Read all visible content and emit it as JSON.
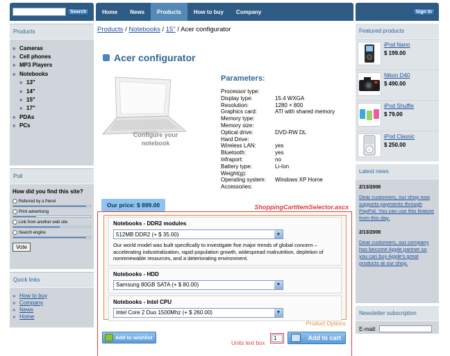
{
  "search": {
    "placeholder": "",
    "button": "Search"
  },
  "nav": {
    "items": [
      "Home",
      "News",
      "Products",
      "How to buy",
      "Company"
    ],
    "active": "Products"
  },
  "signin": "Sign In",
  "left": {
    "products_header": "Products",
    "categories": [
      {
        "label": "Cameras",
        "sub": false
      },
      {
        "label": "Cell phones",
        "sub": false
      },
      {
        "label": "MP3 Players",
        "sub": false
      },
      {
        "label": "Notebooks",
        "sub": false
      },
      {
        "label": "13\"",
        "sub": true
      },
      {
        "label": "14\"",
        "sub": true
      },
      {
        "label": "15\"",
        "sub": true
      },
      {
        "label": "17\"",
        "sub": true
      },
      {
        "label": "PDAs",
        "sub": false
      },
      {
        "label": "PCs",
        "sub": false
      }
    ],
    "poll": {
      "header": "Poll",
      "question": "How did you find this site?",
      "options": [
        {
          "label": "Referred by a friend",
          "share": 0.95
        },
        {
          "label": "Print advertising",
          "share": 0.3
        },
        {
          "label": "Link from another web site",
          "share": 0.6
        },
        {
          "label": "Search engine",
          "share": 0.95
        }
      ],
      "vote": "Vote"
    },
    "quick_links": {
      "header": "Quick links",
      "items": [
        "How to buy",
        "Company",
        "News",
        "Home"
      ]
    }
  },
  "breadcrumb": {
    "items": [
      "Products",
      "Notebooks",
      "15\""
    ],
    "current": "Acer configurator",
    "sep": " / "
  },
  "page_title": "Acer configurator",
  "configure_caption": "Configure your notebook",
  "params": {
    "title": "Parameters:",
    "rows": [
      [
        "Processor type:",
        ""
      ],
      [
        "Display type:",
        "15.4 WXGA"
      ],
      [
        "Resolution:",
        "1280 × 800"
      ],
      [
        "Graphics card:",
        "ATI with shared memory"
      ],
      [
        "Memory type:",
        ""
      ],
      [
        "Memory size:",
        ""
      ],
      [
        "Optical drive:",
        "DVD-RW DL"
      ],
      [
        "Hard Drive:",
        ""
      ],
      [
        "Wireless LAN:",
        "yes"
      ],
      [
        "Bluetooth:",
        "yes"
      ],
      [
        "Infraport:",
        "no"
      ],
      [
        "Battery type:",
        "Li-Ion"
      ],
      [
        "Weight(g):",
        ""
      ],
      [
        "Operating system:",
        "Windows XP Home"
      ],
      [
        "Accessories:",
        ""
      ]
    ]
  },
  "price": {
    "label": "Our price:",
    "value": "$ 899.00"
  },
  "selector_label": "ShoppingCartItemSelector.ascx",
  "options": [
    {
      "title": "Notebooks - DDR2 modules",
      "selected": "512MB DDR2 (+ $ 35.00)",
      "description": "Our world model was built specifically to investigate five major trends of global concern – accelerating industrialization, rapid population growth, widespread malnutrition, depletion of nonrenewable resources, and a deteriorating environment."
    },
    {
      "title": "Notebooks - HDD",
      "selected": "Samsung 80GB SATA (+ $ 80.00)",
      "description": ""
    },
    {
      "title": "Notebooks - Intel CPU",
      "selected": "Intel Core 2 Duo 1500Mhz (+ $ 260.00)",
      "description": ""
    }
  ],
  "product_options_label": "Product Options",
  "wishlist": "Add to wishlist",
  "units": {
    "value": "1",
    "label": "Units text box"
  },
  "add_to_cart": "Add to cart",
  "right": {
    "featured_header": "Featured products",
    "featured": [
      {
        "name": "iPod Nano",
        "price": "$ 199.00",
        "icon": "ipod-nano-icon"
      },
      {
        "name": "Nikon D40",
        "price": "$ 490.00",
        "icon": "camera-icon"
      },
      {
        "name": "iPod Shuffle",
        "price": "$ 79.00",
        "icon": "ipod-shuffle-icon"
      },
      {
        "name": "iPod Classic",
        "price": "$ 250.00",
        "icon": "ipod-classic-icon"
      }
    ],
    "news_header": "Latest news",
    "news": [
      {
        "date": "2/13/2008",
        "text": "Dear customers, our shop now supports payments through PayPal. You can use this feature from this day."
      },
      {
        "date": "2/13/2008",
        "text": "Dear customers, our company has become Apple partner so you can buy Apple's great products at our shop."
      }
    ],
    "newsletter_header": "Newsletter subscription",
    "email_label": "E-mail:"
  },
  "colors": {
    "nav": "#2d5b83",
    "accent": "#2f6696",
    "annotation_red": "#e23b3b",
    "annotation_orange": "#e98a3b"
  }
}
